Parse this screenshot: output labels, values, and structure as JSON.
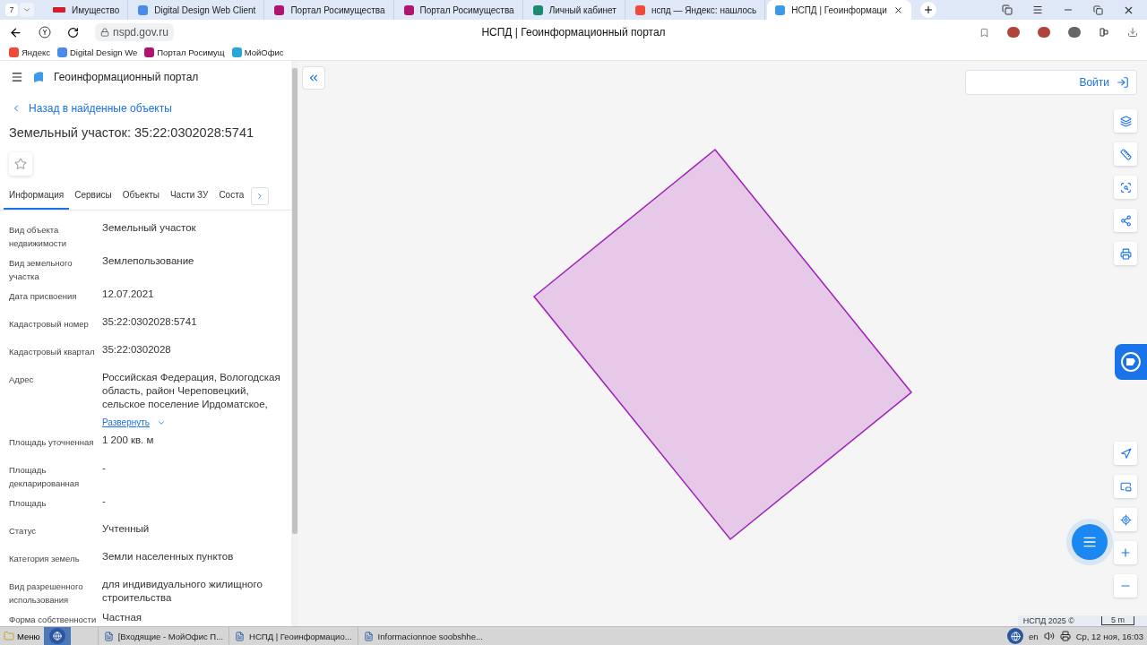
{
  "browser": {
    "tab_count": "7",
    "tabs": [
      {
        "title": "Имущество",
        "selected": false
      },
      {
        "title": "Digital Design Web Client",
        "selected": false
      },
      {
        "title": "Портал Росимущества",
        "selected": false
      },
      {
        "title": "Портал Росимущества",
        "selected": false
      },
      {
        "title": "Личный кабинет",
        "selected": false
      },
      {
        "title": "нспд — Яндекс: нашлось",
        "selected": false
      },
      {
        "title": "НСПД | Геоинформаци",
        "selected": true
      }
    ],
    "url": "nspd.gov.ru",
    "page_title": "НСПД | Геоинформационный портал",
    "bookmarks": [
      "Яндекс",
      "Digital Design We",
      "Портал Росимущ",
      "МойОфис"
    ]
  },
  "sidebar": {
    "portal_title": "Геоинформационный портал",
    "back_link": "Назад в найденные объекты",
    "heading": "Земельный участок: 35:22:0302028:5741",
    "tabs": [
      {
        "label": "Информация",
        "selected": true
      },
      {
        "label": "Сервисы",
        "selected": false
      },
      {
        "label": "Объекты",
        "selected": false
      },
      {
        "label": "Части ЗУ",
        "selected": false
      },
      {
        "label": "Соста",
        "selected": false
      }
    ],
    "fields": [
      {
        "label": "Вид объекта недвижимости",
        "value": "Земельный участок"
      },
      {
        "label": "Вид земельного участка",
        "value": "Землепользование"
      },
      {
        "label": "Дата присвоения",
        "value": "12.07.2021"
      },
      {
        "label": "Кадастровый номер",
        "value": "35:22:0302028:5741"
      },
      {
        "label": "Кадастровый квартал",
        "value": "35:22:0302028"
      },
      {
        "label": "Адрес",
        "value": "Российская Федерация, Вологодская область, район Череповецкий, сельское поселение Ирдоматское,",
        "expand_link": "Развернуть"
      },
      {
        "label": "Площадь уточненная",
        "value": "1 200 кв. м"
      },
      {
        "label": "Площадь декларированная",
        "value": "-"
      },
      {
        "label": "Площадь",
        "value": "-"
      },
      {
        "label": "Статус",
        "value": "Учтенный"
      },
      {
        "label": "Категория земель",
        "value": "Земли населенных пунктов"
      },
      {
        "label": "Вид разрешенного использования",
        "value": "для индивидуального жилищного строительства"
      },
      {
        "label": "Форма собственности",
        "value": "Частная"
      }
    ]
  },
  "map": {
    "login_button": "Войти",
    "attribution": "НСПД 2025 ©",
    "scale": "5 m"
  },
  "taskbar": {
    "menu": "Меню",
    "tasks": [
      "[Входящие - МойОфис П...",
      "НСПД | Геоинформацио...",
      "Informacionnoe soobshhe..."
    ],
    "lang": "en",
    "clock": "Ср, 12 ноя, 16:03"
  }
}
